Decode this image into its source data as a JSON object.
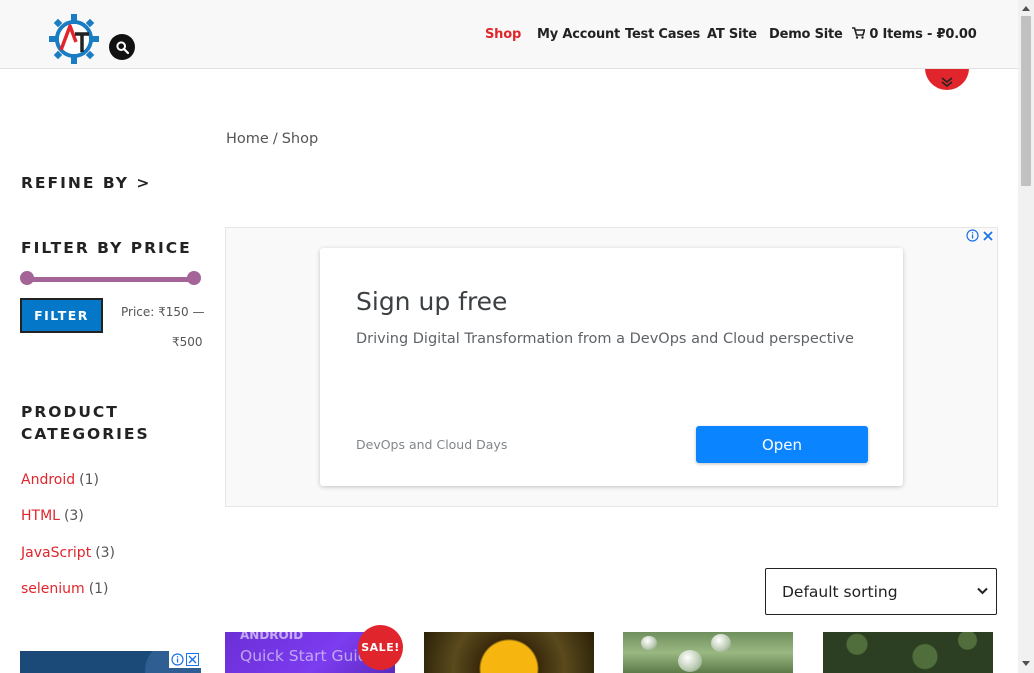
{
  "header": {
    "logo_alt": "AT",
    "nav": [
      {
        "label": "Shop",
        "active": true
      },
      {
        "label": "My Account",
        "active": false
      },
      {
        "label": "Test Cases",
        "active": false
      },
      {
        "label": "AT Site",
        "active": false
      },
      {
        "label": "Demo Site",
        "active": false
      }
    ],
    "cart_label": "0 Items - ₽0.00"
  },
  "breadcrumb": {
    "home": "Home",
    "separator": "/",
    "current": "Shop"
  },
  "sidebar": {
    "refine_title": "REFINE BY >",
    "filter_title": "FILTER BY PRICE",
    "filter_button": "FILTER",
    "price_line1": "Price: ₹150 —",
    "price_line2": "₹500",
    "price_min": 150,
    "price_max": 500,
    "categories_title_1": "PRODUCT",
    "categories_title_2": "CATEGORIES",
    "categories": [
      {
        "name": "Android",
        "count": "(1)"
      },
      {
        "name": "HTML",
        "count": "(3)"
      },
      {
        "name": "JavaScript",
        "count": "(3)"
      },
      {
        "name": "selenium",
        "count": "(1)"
      }
    ]
  },
  "ad": {
    "headline": "Sign up free",
    "description": "Driving Digital Transformation from a DevOps and Cloud perspective",
    "advertiser": "DevOps and Cloud Days",
    "cta": "Open"
  },
  "sorting": {
    "selected": "Default sorting"
  },
  "products": [
    {
      "image_text_1": "ANDROID",
      "image_text_2": "Quick Start Guide",
      "badge": "SALE!"
    },
    {},
    {},
    {}
  ],
  "colors": {
    "accent": "#e0262c",
    "filter_button": "#0577c8",
    "slider": "#a46497",
    "ad_button": "#0a84ff"
  }
}
